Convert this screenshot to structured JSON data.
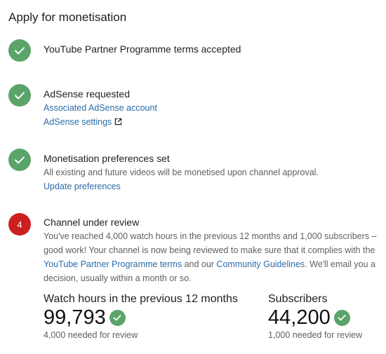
{
  "page": {
    "title": "Apply for monetisation"
  },
  "steps": [
    {
      "status": "done",
      "heading": "YouTube Partner Programme terms accepted"
    },
    {
      "status": "done",
      "heading": "AdSense requested",
      "link1": "Associated AdSense account",
      "link2": "AdSense settings",
      "link2_icon": "external-link-icon"
    },
    {
      "status": "done",
      "heading": "Monetisation preferences set",
      "desc": "All existing and future videos will be monetised upon channel approval.",
      "link1": "Update preferences"
    },
    {
      "status": "in-review",
      "number": "4",
      "heading": "Channel under review",
      "desc_part1": "You've reached 4,000 watch hours in the previous 12 months and 1,000 subscribers – good work! Your channel is now being reviewed to make sure that it complies with the ",
      "desc_link1": "YouTube Partner Programme terms",
      "desc_part2": " and our ",
      "desc_link2": "Community Guidelines",
      "desc_part3": ". We'll email you a decision, usually within a month or so."
    }
  ],
  "stats": {
    "watch_hours": {
      "label": "Watch hours in the previous 12 months",
      "value": "99,793",
      "sub": "4,000 needed for review"
    },
    "subscribers": {
      "label": "Subscribers",
      "value": "44,200",
      "sub": "1,000 needed for review"
    }
  },
  "colors": {
    "check_green": "#5aa469",
    "review_red": "#cc1f1f",
    "link_blue": "#2b6ba6"
  }
}
